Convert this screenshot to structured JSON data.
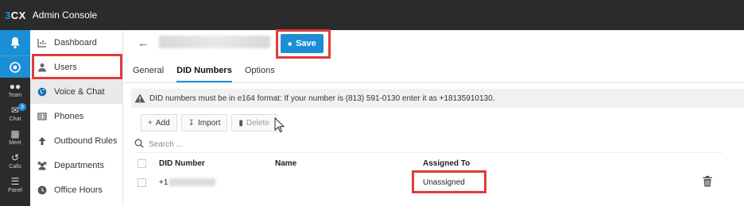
{
  "header": {
    "logo_prefix": "3",
    "logo_suffix": "CX",
    "title": "Admin Console"
  },
  "rail": {
    "items": [
      {
        "label": "Team",
        "icon": "team-icon"
      },
      {
        "label": "Chat",
        "icon": "chat-icon",
        "badge": "3"
      },
      {
        "label": "Meet",
        "icon": "meet-icon"
      },
      {
        "label": "Calls",
        "icon": "calls-icon"
      },
      {
        "label": "Panel",
        "icon": "panel-icon"
      }
    ]
  },
  "sidebar": {
    "items": [
      {
        "label": "Dashboard",
        "icon": "dashboard-icon"
      },
      {
        "label": "Users",
        "icon": "user-icon"
      },
      {
        "label": "Voice & Chat",
        "icon": "globe-icon"
      },
      {
        "label": "Phones",
        "icon": "phone-icon"
      },
      {
        "label": "Outbound Rules",
        "icon": "arrow-up-icon"
      },
      {
        "label": "Departments",
        "icon": "departments-icon"
      },
      {
        "label": "Office Hours",
        "icon": "clock-icon"
      }
    ],
    "active": "Voice & Chat"
  },
  "main": {
    "save_label": "Save",
    "tabs": [
      "General",
      "DID Numbers",
      "Options"
    ],
    "active_tab": "DID Numbers",
    "notice": "DID numbers must be in e164 format: If your number is (813) 591-0130 enter it as +18135910130.",
    "toolbar": {
      "add_label": "Add",
      "import_label": "Import",
      "delete_label": "Delete"
    },
    "search_placeholder": "Search ...",
    "table": {
      "headers": [
        "DID Number",
        "Name",
        "Assigned To"
      ],
      "rows": [
        {
          "did_prefix": "+1",
          "name": "",
          "assigned_to": "Unassigned"
        }
      ]
    }
  },
  "colors": {
    "accent": "#1b8fd6",
    "highlight": "#e23b3b",
    "topbar": "#2b2b2b"
  }
}
